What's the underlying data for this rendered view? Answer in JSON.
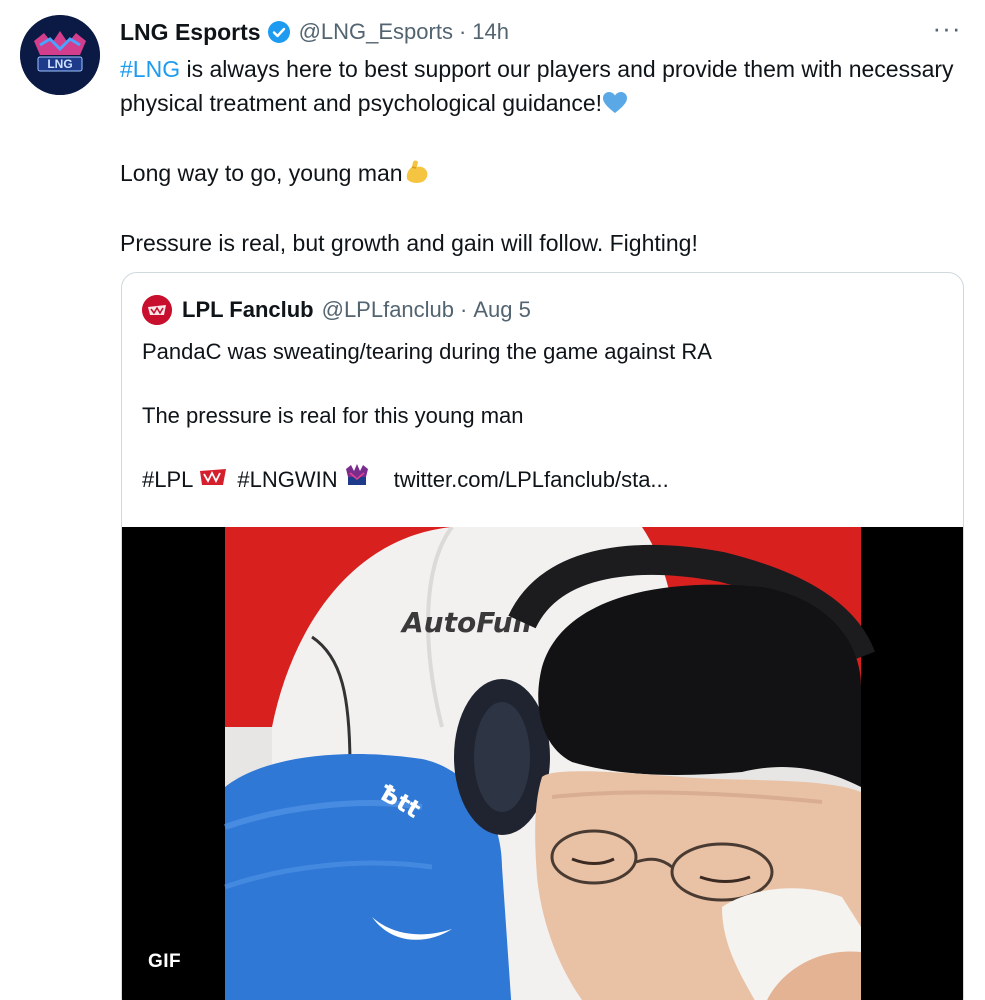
{
  "tweet": {
    "display_name": "LNG Esports",
    "handle": "@LNG_Esports",
    "separator": "·",
    "time": "14h",
    "more_label": "···",
    "hashtag": "#LNG",
    "line1_rest": " is always here to best support our players and provide them with necessary physical treatment and psychological guidance!",
    "line2": "Long way to go, young man",
    "line3": "Pressure is real, but growth and gain will follow. Fighting!",
    "avatar_text": "LNG"
  },
  "quote": {
    "display_name": "LPL Fanclub",
    "handle": "@LPLfanclub",
    "separator": "·",
    "time": "Aug 5",
    "line1": "PandaC was sweating/tearing during the game against RA",
    "line2": "The pressure is real for this young man",
    "tag1": "#LPL",
    "tag2": "#LNGWIN",
    "link": "twitter.com/LPLfanclub/sta..."
  },
  "media": {
    "badge": "GIF",
    "chair_brand": "AutoFull"
  },
  "colors": {
    "accent": "#1d9bf0",
    "text": "#0f1419",
    "secondary": "#536471",
    "border": "#cfd9de"
  }
}
